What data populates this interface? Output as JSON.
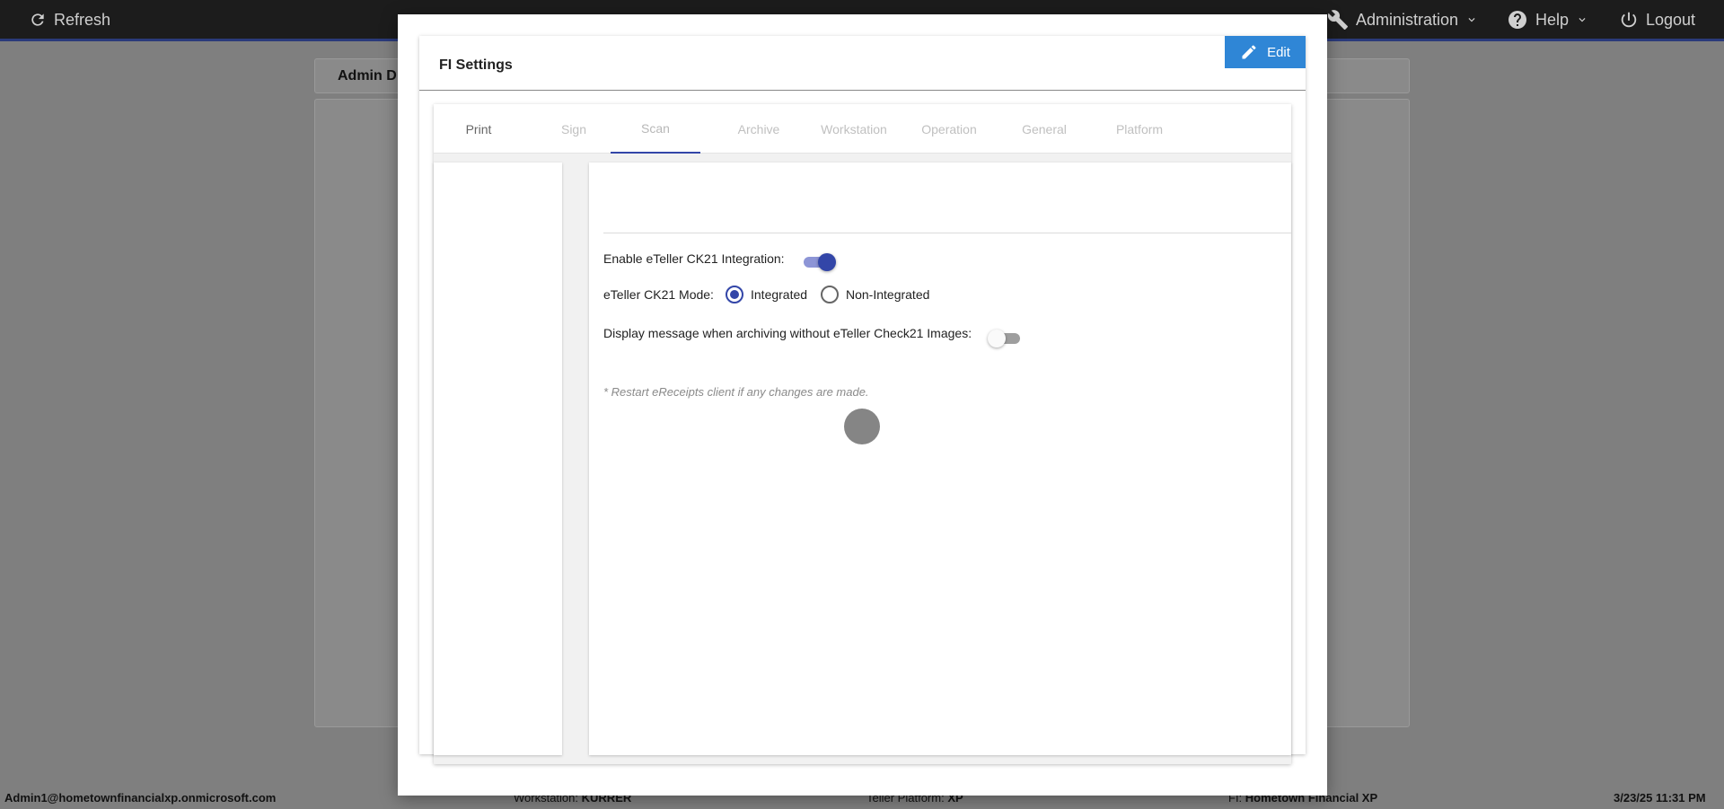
{
  "topbar": {
    "refresh_label": "Refresh",
    "administration_label": "Administration",
    "help_label": "Help",
    "logout_label": "Logout"
  },
  "background": {
    "header_title": "Admin D"
  },
  "footer": {
    "user": "Admin1@hometownfinancialxp.onmicrosoft.com",
    "workstation_label": "Workstation:",
    "workstation_value": "KURRER",
    "platform_label": "Teller Platform:",
    "platform_value": "XP",
    "fi_label": "FI:",
    "fi_value": "Hometown Financial XP",
    "datetime": "3/23/25 11:31 PM"
  },
  "modal": {
    "title": "FI Settings",
    "edit_label": "Edit",
    "tabs": [
      {
        "label": "Print",
        "state": "done"
      },
      {
        "label": "Sign",
        "state": "disabled"
      },
      {
        "label": "Scan",
        "state": "active"
      },
      {
        "label": "Archive",
        "state": "disabled"
      },
      {
        "label": "Workstation",
        "state": "disabled"
      },
      {
        "label": "Operation",
        "state": "disabled"
      },
      {
        "label": "General",
        "state": "disabled"
      },
      {
        "label": "Platform",
        "state": "disabled"
      }
    ],
    "settings": {
      "enable_ck21_label": "Enable eTeller CK21 Integration:",
      "enable_ck21_value": true,
      "mode_label": "eTeller CK21 Mode:",
      "mode_options": [
        "Integrated",
        "Non-Integrated"
      ],
      "mode_selected": "Integrated",
      "display_message_label": "Display message when archiving without eTeller Check21 Images:",
      "display_message_value": false,
      "restart_note": "* Restart eReceipts client if any changes are made."
    }
  },
  "colors": {
    "accent": "#3346a8",
    "edit_button": "#2f86d6",
    "topbar": "#1c1c1c",
    "overlay": "#7f7f7f"
  }
}
